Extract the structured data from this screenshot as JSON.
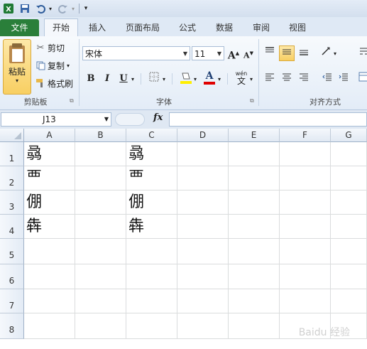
{
  "quick_access": {
    "icons": [
      "excel-logo-icon",
      "save-icon",
      "undo-icon",
      "redo-icon",
      "customize-icon"
    ]
  },
  "tabs": {
    "file": "文件",
    "home": "开始",
    "insert": "插入",
    "layout": "页面布局",
    "formulas": "公式",
    "data": "数据",
    "review": "审阅",
    "view": "视图"
  },
  "clipboard": {
    "paste": "粘贴",
    "cut": "剪切",
    "copy": "复制",
    "format_painter": "格式刷",
    "group": "剪贴板"
  },
  "font": {
    "name": "宋体",
    "size": "11",
    "bold": "B",
    "italic": "I",
    "underline": "U",
    "grow": "A",
    "shrink": "A",
    "font_color_letter": "A",
    "phonetic": "wén",
    "phonetic_char": "文",
    "group": "字体"
  },
  "alignment": {
    "group": "对齐方式"
  },
  "formula_bar": {
    "cell_ref": "J13",
    "fx": "fx"
  },
  "columns": [
    "A",
    "B",
    "C",
    "D",
    "E",
    "F",
    "G"
  ],
  "rows": [
    "1",
    "2",
    "3",
    "4",
    "5",
    "6",
    "7",
    "8"
  ],
  "cells": {
    "A1": "骉",
    "C1": "骉",
    "A2": "覀",
    "C2": "覀",
    "A3": "倗",
    "C3": "倗",
    "A4": "犇",
    "C4": "犇"
  },
  "watermark": "Baidu 经验"
}
